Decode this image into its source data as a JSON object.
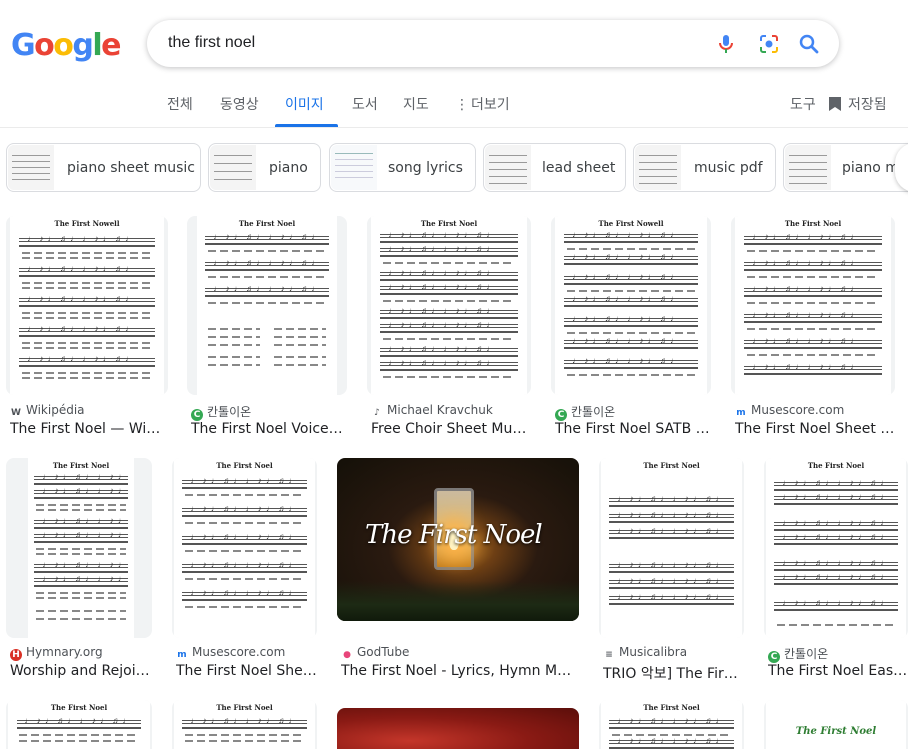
{
  "search": {
    "query": "the first noel"
  },
  "logo": {
    "letters": [
      "G",
      "o",
      "o",
      "g",
      "l",
      "e"
    ],
    "colors": [
      "#4285F4",
      "#EA4335",
      "#FBBC05",
      "#4285F4",
      "#34A853",
      "#EA4335"
    ]
  },
  "tabs": [
    {
      "label": "전체"
    },
    {
      "label": "동영상"
    },
    {
      "label": "이미지"
    },
    {
      "label": "도서"
    },
    {
      "label": "지도"
    },
    {
      "label": "더보기"
    }
  ],
  "tools": {
    "label": "도구",
    "saved": "저장됨"
  },
  "chips": [
    {
      "label": "piano sheet music"
    },
    {
      "label": "piano"
    },
    {
      "label": "song lyrics"
    },
    {
      "label": "lead sheet"
    },
    {
      "label": "music pdf"
    },
    {
      "label": "piano m"
    }
  ],
  "results": [
    {
      "source": "Wikipédia",
      "title": "The First Noel — Wiki...",
      "sheet_title": "The First Nowell",
      "icon": "W",
      "icon_color": "#202124"
    },
    {
      "source": "칸톨이온",
      "title": "The First Noel Voice - ...",
      "sheet_title": "The First Noel",
      "icon": "C",
      "icon_color": "#34a853"
    },
    {
      "source": "Michael Kravchuk",
      "title": "Free Choir Sheet Musi...",
      "sheet_title": "The First Noel",
      "icon": "♪",
      "icon_color": "#202124"
    },
    {
      "source": "칸톨이온",
      "title": "The First Noel SATB - ...",
      "sheet_title": "The First Nowell",
      "icon": "C",
      "icon_color": "#34a853"
    },
    {
      "source": "Musescore.com",
      "title": "The First Noel Sheet mu...",
      "sheet_title": "The First Noel",
      "icon": "m",
      "icon_color": "#1a73e8"
    },
    {
      "source": "Hymnary.org",
      "title": "Worship and Rejoic...",
      "sheet_title": "The First Noel",
      "icon": "H",
      "icon_color": "#d93025"
    },
    {
      "source": "Musescore.com",
      "title": "The First Noel Shee...",
      "sheet_title": "The First Noel",
      "icon": "m",
      "icon_color": "#1a73e8"
    },
    {
      "source": "GodTube",
      "title": "The First Noel - Lyrics, Hymn Mean...",
      "overlay_text": "The First Noel",
      "icon": "●",
      "icon_color": "#e8457a"
    },
    {
      "source": "Musicalibra",
      "title": "TRIO 악보] The First...",
      "sheet_title": "The First Noel",
      "icon": "≡",
      "icon_color": "#5f6368"
    },
    {
      "source": "칸톨이온",
      "title": "The First Noel Easy ...",
      "sheet_title": "The First Noel",
      "icon": "C",
      "icon_color": "#34a853"
    }
  ],
  "bottom_row": [
    {
      "sheet_title": "The First Noel"
    },
    {
      "sheet_title": "The First Noel"
    },
    {
      "sheet_title": ""
    },
    {
      "sheet_title": "The First Noel"
    },
    {
      "sheet_title": "The First Noel"
    }
  ]
}
